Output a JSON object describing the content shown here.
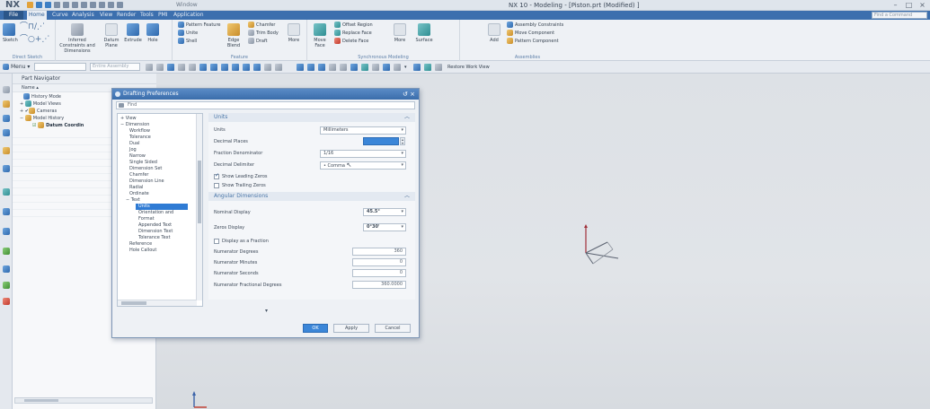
{
  "app": {
    "logo": "NX",
    "window_menu": "Window",
    "title": "NX 10 - Modeling - [Piston.prt (Modified) ]"
  },
  "menu_tabs": [
    "File",
    "Home",
    "Curve",
    "Analysis",
    "View",
    "Render",
    "Tools",
    "PMI",
    "Application"
  ],
  "command_finder_placeholder": "Find a Command",
  "ribbon": {
    "direct_sketch": {
      "sketch": "Sketch",
      "group_label": "Direct Sketch"
    },
    "inferred_constraints": "Inferred Constraints and Dimensions",
    "datum_plane": "Datum Plane",
    "extrude": "Extrude",
    "hole": "Hole",
    "pattern_feature": "Pattern Feature",
    "unite": "Unite",
    "shell": "Shell",
    "edge_blend": "Edge Blend",
    "chamfer": "Chamfer",
    "trim_body": "Trim Body",
    "draft": "Draft",
    "more": "More",
    "feature_label": "Feature",
    "move_face": "Move Face",
    "offset_region": "Offset Region",
    "replace_face": "Replace Face",
    "delete_face": "Delete Face",
    "synchronous_label": "Synchronous Modeling",
    "surface": "Surface",
    "add": "Add",
    "assembly_constraints": "Assembly Constraints",
    "move_component": "Move Component",
    "pattern_component": "Pattern Component",
    "assemblies_label": "Assemblies"
  },
  "toolbar2": {
    "menu": "Menu",
    "selection_filter": "Entire Assembly",
    "restore": "Restore Work View"
  },
  "navigator": {
    "title": "Part Navigator",
    "column": "Name",
    "nodes": [
      "History Mode",
      "Model Views",
      "Cameras",
      "Model History",
      "Datum Coordin"
    ]
  },
  "dialog": {
    "title": "Drafting Preferences",
    "find": "Find",
    "tree": [
      "View",
      "Dimension",
      "Workflow",
      "Tolerance",
      "Dual",
      "Jog",
      "Narrow",
      "Single Sided",
      "Dimension Set",
      "Chamfer",
      "Dimension Line",
      "Radial",
      "Ordinate",
      "Text",
      "Units",
      "Orientation and",
      "Format",
      "Appended Text",
      "Dimension Text",
      "Tolerance Text",
      "Reference",
      "Hole Callout"
    ],
    "units_section": "Units",
    "units_label": "Units",
    "units_value": "Millimeters",
    "decimal_places_label": "Decimal Places",
    "fraction_denominator_label": "Fraction Denominator",
    "fraction_denominator_value": "1/16",
    "decimal_delimiter_label": "Decimal Delimiter",
    "decimal_delimiter_value": "• Comma",
    "show_leading_zeros": "Show Leading Zeros",
    "show_trailing_zeros": "Show Trailing Zeros",
    "angular_section": "Angular Dimensions",
    "nominal_display_label": "Nominal Display",
    "nominal_display_value": "45.5°",
    "zeros_display_label": "Zeros Display",
    "zeros_display_value": "0°30'",
    "display_as_fraction": "Display as a Fraction",
    "numerator_degrees_label": "Numerator Degrees",
    "numerator_degrees_value": "360",
    "numerator_minutes_label": "Numerator Minutes",
    "numerator_minutes_value": "0",
    "numerator_seconds_label": "Numerator Seconds",
    "numerator_seconds_value": "0",
    "numerator_fractional_label": "Numerator Fractional Degrees",
    "numerator_fractional_value": "360.0000",
    "ok": "OK",
    "apply": "Apply",
    "cancel": "Cancel"
  }
}
